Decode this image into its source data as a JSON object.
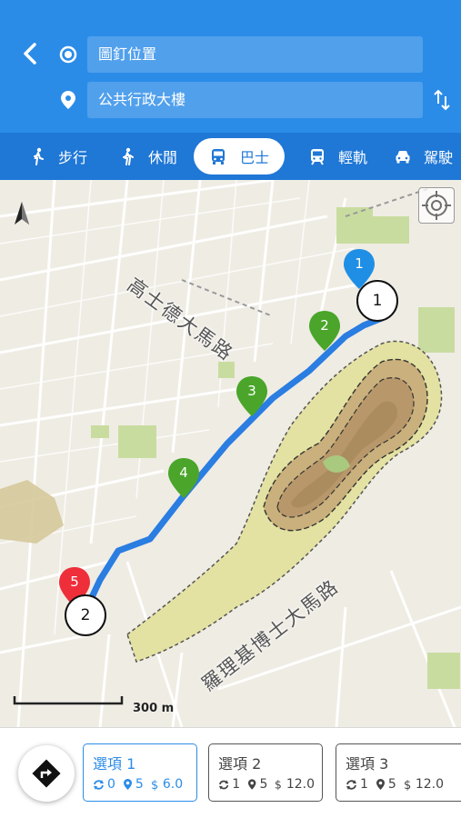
{
  "header": {
    "origin_value": "圖釘位置",
    "destination_value": "公共行政大樓"
  },
  "icons": {
    "back": "chevron-left-icon",
    "origin": "target-circle-icon",
    "destination": "map-pin-icon",
    "swap": "swap-vertical-icon"
  },
  "modes": [
    {
      "label": "步行",
      "icon": "walk-icon",
      "active": false
    },
    {
      "label": "休閒",
      "icon": "hike-icon",
      "active": false
    },
    {
      "label": "巴士",
      "icon": "bus-icon",
      "active": true
    },
    {
      "label": "輕軌",
      "icon": "tram-icon",
      "active": false
    },
    {
      "label": "駕駛",
      "icon": "car-icon",
      "active": false
    }
  ],
  "map": {
    "street_labels": [
      "高士德大馬路",
      "羅理基博士大馬路"
    ],
    "scale_label": "300 m",
    "stop_markers": [
      "1",
      "2",
      "3",
      "4",
      "5"
    ],
    "endpoint_circles": [
      "1",
      "2"
    ],
    "colors": {
      "route": "#2a7de1",
      "marker_start": "#1f8fe5",
      "marker_mid": "#4aa52a",
      "marker_end": "#ee2f3a",
      "park": "#c9dca0",
      "hill": "#c7a978"
    }
  },
  "options": [
    {
      "title": "選項 1",
      "transfers": "0",
      "stops": "5",
      "fare": "6.0",
      "active": true
    },
    {
      "title": "選項 2",
      "transfers": "1",
      "stops": "5",
      "fare": "12.0",
      "active": false
    },
    {
      "title": "選項 3",
      "transfers": "1",
      "stops": "5",
      "fare": "12.0",
      "active": false
    }
  ],
  "bottom": {
    "directions_icon": "turn-right-diamond-icon"
  }
}
